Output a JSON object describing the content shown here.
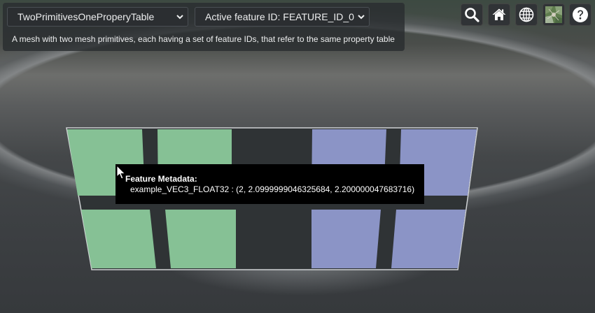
{
  "toolbar": {
    "model_select_value": "TwoPrimitivesOneProperyTable",
    "feature_id_select_value": "Active feature ID: FEATURE_ID_0",
    "description": "A mesh with two mesh primitives, each having a set of feature IDs, that refer to the same property table"
  },
  "icons": {
    "search": "search-icon",
    "home": "home-icon",
    "scene_mode": "globe-icon",
    "base_layer": "imagery-thumbnail",
    "help": "help-icon"
  },
  "tooltip": {
    "title": "Feature Metadata:",
    "line": "example_VEC3_FLOAT32 : (2, 2.0999999046325684, 2.200000047683716)"
  },
  "colors": {
    "feature_green": "#86c195",
    "feature_blue": "#8b94c6",
    "mesh_dark": "#2f3335"
  }
}
